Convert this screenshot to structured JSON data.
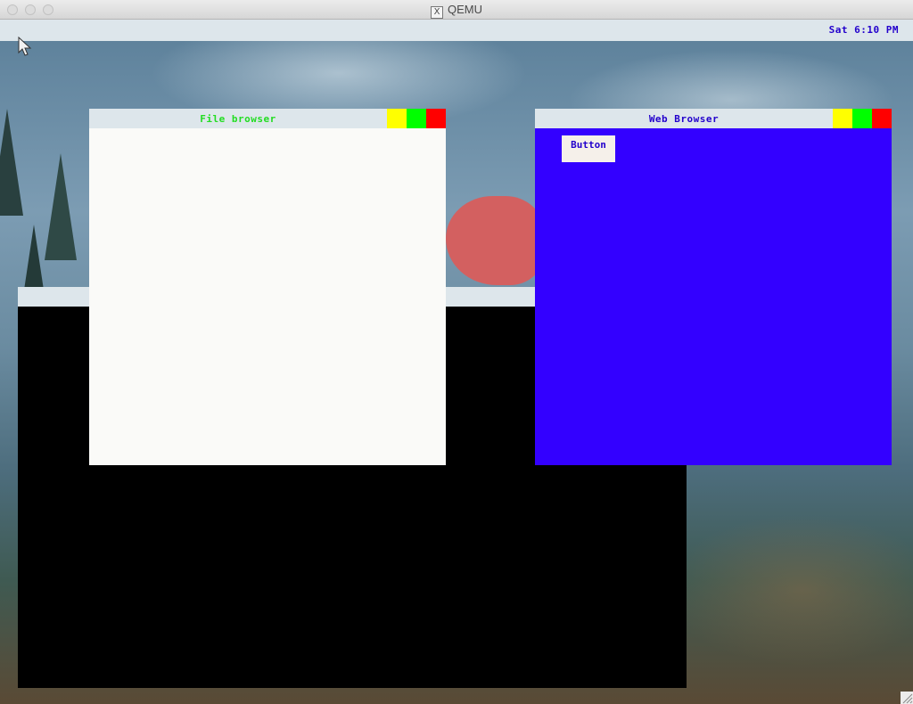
{
  "host_window": {
    "title": "QEMU",
    "app_icon": "x11-icon"
  },
  "menubar": {
    "clock": "Sat 6:10 PM"
  },
  "windows": {
    "terminal": {
      "title": "",
      "body_color": "#000000"
    },
    "file_browser": {
      "title": "File browser",
      "title_color": "#22dd22",
      "body_color": "#fafaf8"
    },
    "web_browser": {
      "title": "Web Browser",
      "title_color": "#2200cc",
      "body_color": "#3300ff",
      "button_label": "Button"
    }
  },
  "window_controls": {
    "colors": [
      "#ffff00",
      "#00ff00",
      "#ff0000"
    ]
  },
  "icons": [
    "mouse-pointer-icon",
    "x11-icon",
    "resize-grip-icon"
  ]
}
